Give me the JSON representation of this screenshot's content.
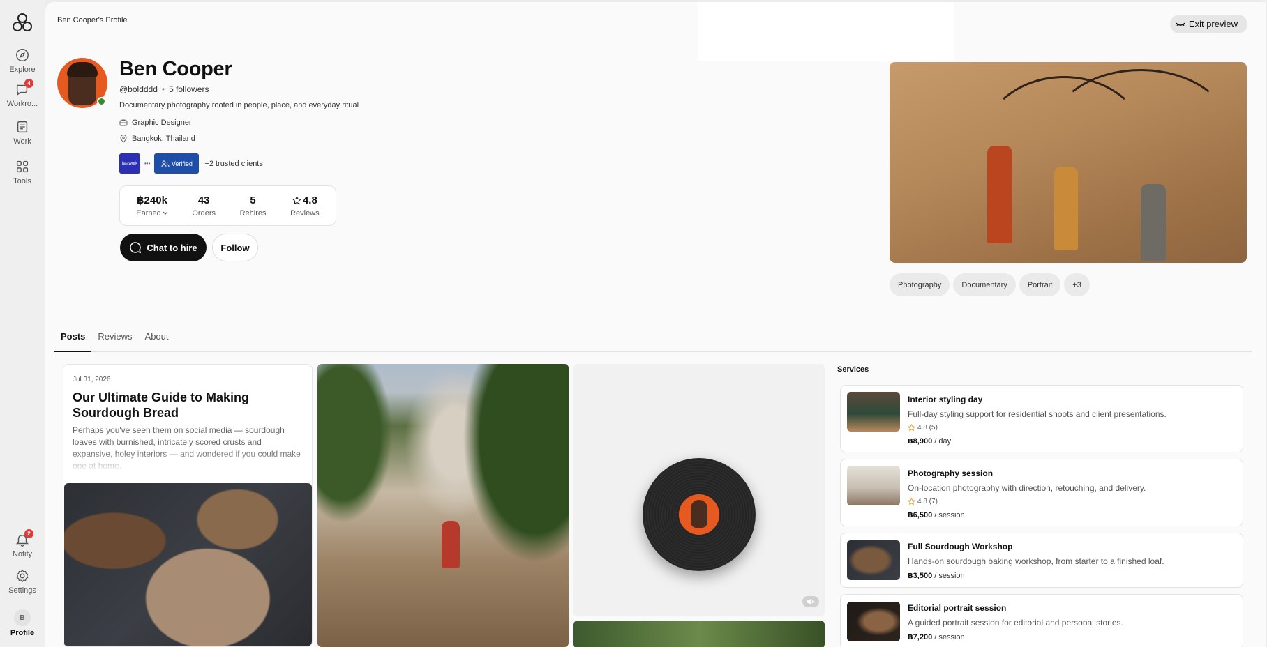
{
  "sidebar": {
    "items": [
      {
        "label": "Explore",
        "icon": "compass-icon"
      },
      {
        "label": "Workro...",
        "icon": "chat-bubble-icon",
        "badge": "4"
      },
      {
        "label": "Work",
        "icon": "document-icon"
      },
      {
        "label": "Tools",
        "icon": "grid-icon"
      }
    ],
    "bottom": [
      {
        "label": "Notify",
        "icon": "bell-icon",
        "badge": "2"
      },
      {
        "label": "Settings",
        "icon": "gear-icon"
      },
      {
        "label": "Profile",
        "initial": "B"
      }
    ]
  },
  "header": {
    "breadcrumb": "Ben Cooper's Profile",
    "exit_preview": "Exit preview"
  },
  "profile": {
    "name": "Ben Cooper",
    "handle": "@boldddd",
    "followers": "5 followers",
    "bio": "Documentary photography rooted in people, place, and everyday ritual",
    "role": "Graphic Designer",
    "location": "Bangkok, Thailand",
    "client_logo": "fastwork",
    "verified": "Verified",
    "trusted_clients": "+2 trusted clients",
    "stats": [
      {
        "value": "฿240k",
        "label": "Earned"
      },
      {
        "value": "43",
        "label": "Orders"
      },
      {
        "value": "5",
        "label": "Rehires"
      },
      {
        "value": "4.8",
        "label": "Reviews"
      }
    ],
    "chat_button": "Chat to hire",
    "follow_button": "Follow",
    "tags": [
      "Photography",
      "Documentary",
      "Portrait",
      "+3"
    ]
  },
  "tabs": [
    "Posts",
    "Reviews",
    "About"
  ],
  "post": {
    "date": "Jul 31, 2026",
    "title": "Our Ultimate Guide to Making Sourdough Bread",
    "excerpt": "Perhaps you've seen them on social media — sourdough loaves with burnished, intricately scored crusts and expansive, holey interiors — and wondered if you could make one at home."
  },
  "services": {
    "title": "Services",
    "items": [
      {
        "title": "Interior styling day",
        "desc": "Full-day styling support for residential shoots and client presentations.",
        "rating": "4.8 (5)",
        "price": "฿8,900",
        "unit": "/ day"
      },
      {
        "title": "Photography session",
        "desc": "On-location photography with direction, retouching, and delivery.",
        "rating": "4.8 (7)",
        "price": "฿6,500",
        "unit": "/ session"
      },
      {
        "title": "Full Sourdough Workshop",
        "desc": "Hands-on sourdough baking workshop, from starter to a finished loaf.",
        "rating": "",
        "price": "฿3,500",
        "unit": "/ session"
      },
      {
        "title": "Editorial portrait session",
        "desc": "A guided portrait session for editorial and personal stories.",
        "rating": "",
        "price": "฿7,200",
        "unit": "/ session"
      }
    ]
  },
  "colors": {
    "accent_orange": "#e65a22",
    "badge_red": "#e53935",
    "online_green": "#3a8b2c",
    "primary_button": "#111111"
  }
}
